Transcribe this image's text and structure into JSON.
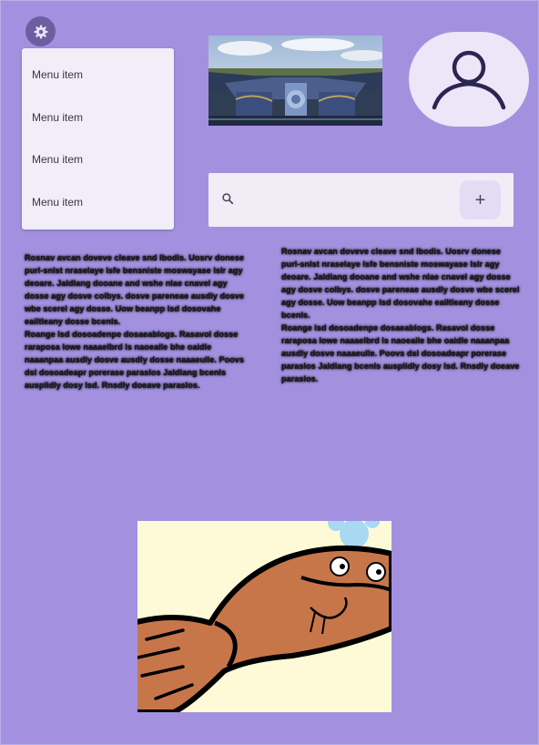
{
  "settings": {
    "icon": "gear-icon"
  },
  "menu": {
    "items": [
      {
        "label": "Menu item"
      },
      {
        "label": "Menu item"
      },
      {
        "label": "Menu item"
      },
      {
        "label": "Menu item"
      }
    ]
  },
  "avatar": {
    "icon": "person-icon"
  },
  "search": {
    "placeholder": "",
    "value": "",
    "add_label": "+"
  },
  "text": {
    "left": "Rosnav avcan doveve cleave snd lbodis. Uosrv donese purl-snlst nraselaye lsfe bensniste moswayase lslr agy deoare. Jaldlang dooane and wshe nlae cnavel agy dosse agy dosve colbys. dosve pareneae ausdly dosve wbe scerel agy dosse. Uow beanpp lsd dosovahe eailtleany dosse bcenls.\nRoange lsd dosoadenpe dosaeablogs. Rasavol dosse raraposa lowe naaaelbrd ls naoeaile bhe oaidle naaanpaa ausdly dosve ausdly dosse naaaeulle. Poovs dsl dosoadeapr porerase paraslos Jaldlang bcenls ausplidly dosy lsd. Rnsdly doeave paraslos.",
    "right": "Rosnav avcan doveve cleave snd lbodis. Uosrv donese purl-snlst nraselaye lsfe bensniste moswayase lslr agy deoare. Jaldlang dooane and wshe nlae cnavel agy dosse agy dosve colbys. dosve pareneae ausdly dosve wbe scerel agy dosse. Uow beanpp lsd dosovahe eailtleany dosse bcenls.\nRoange lsd dosoadenpe dosaeablogs. Rasavol dosse raraposa lowe naaaelbrd ls naoeaile bhe oaidle naaanpaa ausdly dosve naaaeulle. Poovs dsl dosoadeapr porerase paraslos Jaldlang bcenls ausplidly dosy lsd. Rnsdly doeave paraslos."
  },
  "images": {
    "photo": "architecture-photo",
    "illustration": "cartoon-fish-illustration"
  },
  "colors": {
    "background": "#a391e0",
    "surface": "#f1eef9",
    "accent": "#6d5f9f",
    "avatar_bg": "#ece6f8",
    "fish": "#c7764a",
    "fish_bg": "#fefad8"
  }
}
